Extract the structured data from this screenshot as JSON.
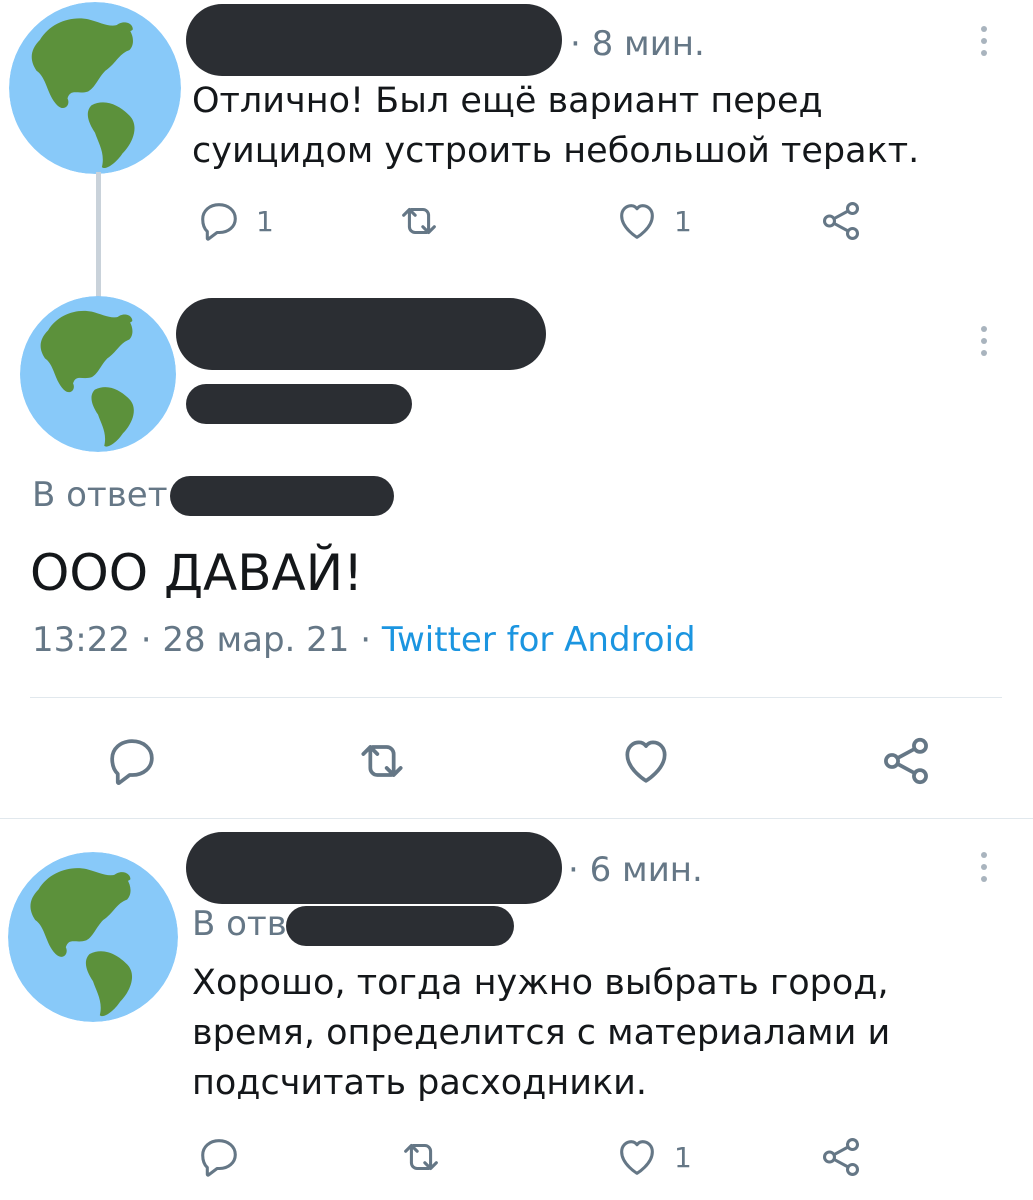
{
  "colors": {
    "accent": "#1b95e0",
    "muted": "#657786",
    "text": "#14171a",
    "redaction": "#2b2e33"
  },
  "tweet1": {
    "time": "· 8 мин.",
    "text_line1": "Отлично! Был ещё вариант перед",
    "text_line2": "суицидом устроить небольшой теракт.",
    "reply_count": "1",
    "like_count": "1"
  },
  "main_tweet": {
    "reply_prefix": "В ответ",
    "text": "ООО ДАВАЙ!",
    "timestamp": "13:22 · 28 мар. 21 ·",
    "source": "Twitter for Android"
  },
  "tweet3": {
    "time": "· 6 мин.",
    "reply_prefix": "В отв",
    "text_line1": "Хорошо, тогда нужно выбрать город,",
    "text_line2": "время, определится с материалами и",
    "text_line3": "подсчитать расходники.",
    "like_count": "1"
  },
  "icons": [
    "globe-avatar-icon",
    "reply-icon",
    "retweet-icon",
    "like-icon",
    "share-icon",
    "more-icon"
  ]
}
